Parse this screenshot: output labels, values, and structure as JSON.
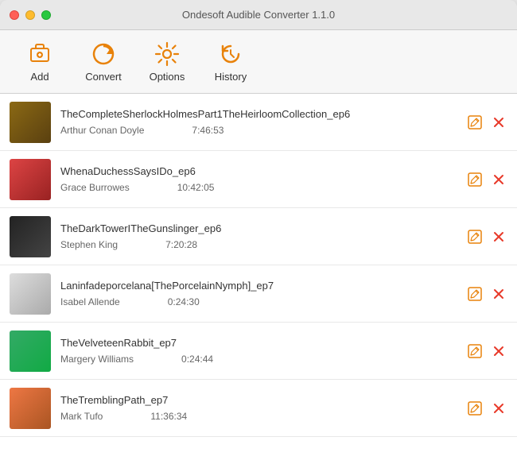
{
  "window": {
    "title": "Ondesoft Audible Converter 1.1.0"
  },
  "toolbar": {
    "buttons": [
      {
        "id": "add",
        "label": "Add",
        "icon": "add-icon"
      },
      {
        "id": "convert",
        "label": "Convert",
        "icon": "convert-icon"
      },
      {
        "id": "options",
        "label": "Options",
        "icon": "options-icon"
      },
      {
        "id": "history",
        "label": "History",
        "icon": "history-icon"
      }
    ]
  },
  "books": [
    {
      "title": "TheCompleteSherlockHolmesPart1TheHeirloomCollection_ep6",
      "author": "Arthur Conan Doyle",
      "duration": "7:46:53",
      "coverClass": "cover-1"
    },
    {
      "title": "WhenaDuchessSaysIDo_ep6",
      "author": "Grace Burrowes",
      "duration": "10:42:05",
      "coverClass": "cover-2"
    },
    {
      "title": "TheDarkTowerITheGunslinger_ep6",
      "author": "Stephen King",
      "duration": "7:20:28",
      "coverClass": "cover-3"
    },
    {
      "title": "Laninfadeporcelana[ThePorcelainNymph]_ep7",
      "author": "Isabel Allende",
      "duration": "0:24:30",
      "coverClass": "cover-4"
    },
    {
      "title": "TheVelveteenRabbit_ep7",
      "author": "Margery Williams",
      "duration": "0:24:44",
      "coverClass": "cover-5"
    },
    {
      "title": "TheTremblingPath_ep7",
      "author": "Mark Tufo",
      "duration": "11:36:34",
      "coverClass": "cover-6"
    }
  ],
  "actions": {
    "edit_symbol": "✎",
    "delete_symbol": "✕"
  }
}
